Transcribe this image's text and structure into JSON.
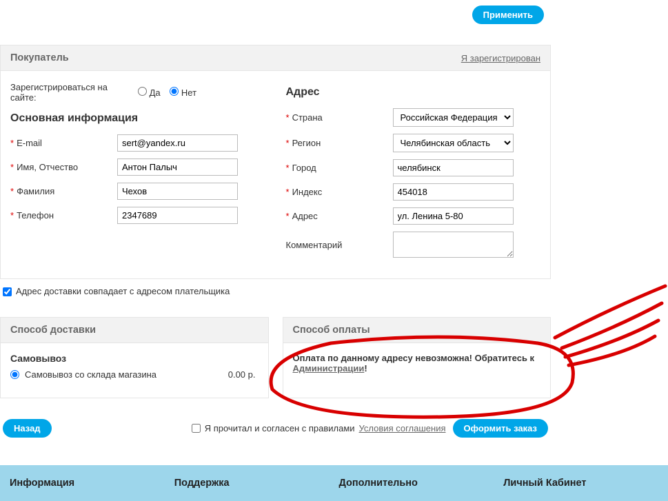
{
  "topButton": "Применить",
  "buyer": {
    "title": "Покупатель",
    "registeredLink": "Я зарегистрирован"
  },
  "registerLabel": "Зарегистрироваться на сайте:",
  "yes": "Да",
  "no": "Нет",
  "mainInfoTitle": "Основная информация",
  "addressTitle": "Адрес",
  "fields": {
    "email": {
      "label": "E-mail",
      "value": "sert@yandex.ru"
    },
    "name": {
      "label": "Имя, Отчество",
      "value": "Антон Палыч"
    },
    "surname": {
      "label": "Фамилия",
      "value": "Чехов"
    },
    "phone": {
      "label": "Телефон",
      "value": "2347689"
    },
    "country": {
      "label": "Страна",
      "value": "Российская Федерация"
    },
    "region": {
      "label": "Регион",
      "value": "Челябинская область"
    },
    "city": {
      "label": "Город",
      "value": "челябинск"
    },
    "zip": {
      "label": "Индекс",
      "value": "454018"
    },
    "addr": {
      "label": "Адрес",
      "value": "ул. Ленина 5-80"
    },
    "comment": {
      "label": "Комментарий",
      "value": ""
    }
  },
  "sameAddress": "Адрес доставки совпадает с адресом плательщика",
  "shipping": {
    "header": "Способ доставки",
    "title": "Самовывоз",
    "option": "Самовывоз со склада магазина",
    "price": "0.00 р."
  },
  "payment": {
    "header": "Способ оплаты",
    "msg1": "Оплата по данному адресу невозможна! Обратитесь к ",
    "link": "Администрации",
    "msg2": "!"
  },
  "back": "Назад",
  "termsText": "Я прочитал и согласен с правилами ",
  "termsLink": "Условия соглашения",
  "checkout": "Оформить заказ",
  "footer": {
    "c1": "Информация",
    "c2": "Поддержка",
    "c3": "Дополнительно",
    "c4": "Личный Кабинет"
  }
}
